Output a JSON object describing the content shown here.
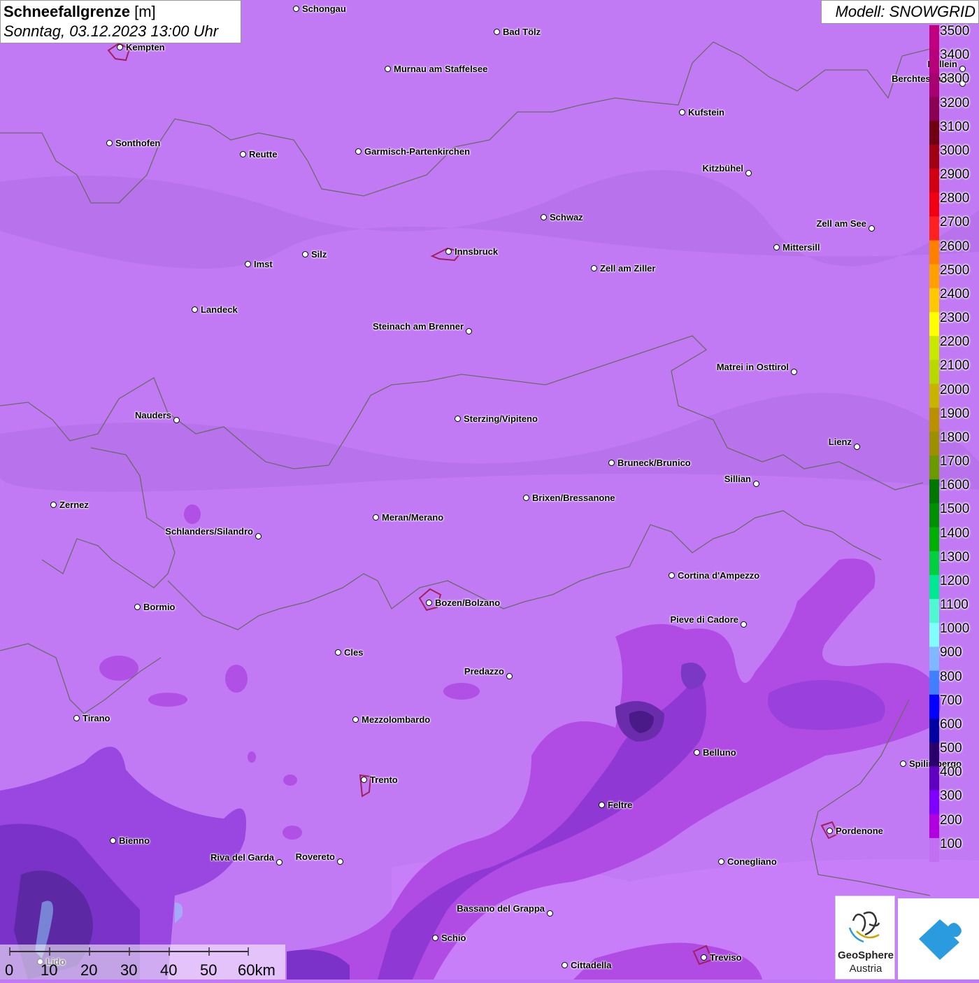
{
  "title": {
    "main": "Schneefallgrenze",
    "unit": "[m]",
    "datetime": "Sonntag, 03.12.2023 13:00 Uhr"
  },
  "model": "Modell: SNOWGRID",
  "legend": {
    "labels": [
      "3500",
      "3400",
      "3300",
      "3200",
      "3100",
      "3000",
      "2900",
      "2800",
      "2700",
      "2600",
      "2500",
      "2400",
      "2300",
      "2200",
      "2100",
      "2000",
      "1900",
      "1800",
      "1700",
      "1600",
      "1500",
      "1400",
      "1300",
      "1200",
      "1100",
      "1000",
      "900",
      "800",
      "700",
      "600",
      "500",
      "400",
      "300",
      "200",
      "100"
    ],
    "colors": [
      "#c0007e",
      "#b8007a",
      "#a80070",
      "#8a0052",
      "#6e0012",
      "#a00010",
      "#d00010",
      "#f00010",
      "#ff2020",
      "#ff8000",
      "#ffa000",
      "#ffc800",
      "#ffff00",
      "#c8e800",
      "#b8d800",
      "#c8b400",
      "#b89000",
      "#9a9000",
      "#6a9a00",
      "#007800",
      "#009000",
      "#00b000",
      "#00d040",
      "#00e890",
      "#50f8d0",
      "#80ffff",
      "#80b8ff",
      "#4080ff",
      "#0000ff",
      "#0000a0",
      "#2a006a",
      "#6000c0",
      "#8000ff",
      "#b000e0",
      "#c070f0"
    ]
  },
  "cities": [
    {
      "name": "Schongau"
    },
    {
      "name": "Bad Tölz"
    },
    {
      "name": "Kempten"
    },
    {
      "name": "Murnau am Staffelsee"
    },
    {
      "name": "Berchtesgaden"
    },
    {
      "name": "Kufstein"
    },
    {
      "name": "Sonthofen"
    },
    {
      "name": "Reutte"
    },
    {
      "name": "Garmisch-Partenkirchen"
    },
    {
      "name": "Kitzbühel"
    },
    {
      "name": "Schwaz"
    },
    {
      "name": "Zell am See"
    },
    {
      "name": "Mittersill"
    },
    {
      "name": "Innsbruck"
    },
    {
      "name": "Silz"
    },
    {
      "name": "Imst"
    },
    {
      "name": "Zell am Ziller"
    },
    {
      "name": "Landeck"
    },
    {
      "name": "Steinach am Brenner"
    },
    {
      "name": "Matrei in Osttirol"
    },
    {
      "name": "Nauders"
    },
    {
      "name": "Sterzing/Vipiteno"
    },
    {
      "name": "Lienz"
    },
    {
      "name": "Bruneck/Brunico"
    },
    {
      "name": "Sillian"
    },
    {
      "name": "Zernez"
    },
    {
      "name": "Brixen/Bressanone"
    },
    {
      "name": "Meran/Merano"
    },
    {
      "name": "Schlanders/Silandro"
    },
    {
      "name": "Cortina d'Ampezzo"
    },
    {
      "name": "Bormio"
    },
    {
      "name": "Bozen/Bolzano"
    },
    {
      "name": "Pieve di Cadore"
    },
    {
      "name": "Cles"
    },
    {
      "name": "Predazzo"
    },
    {
      "name": "Tirano"
    },
    {
      "name": "Mezzolombardo"
    },
    {
      "name": "Belluno"
    },
    {
      "name": "Spilimbergo"
    },
    {
      "name": "Trento"
    },
    {
      "name": "Feltre"
    },
    {
      "name": "Pordenone"
    },
    {
      "name": "Bienno"
    },
    {
      "name": "Riva del Garda"
    },
    {
      "name": "Rovereto"
    },
    {
      "name": "Conegliano"
    },
    {
      "name": "Bassano del Grappa"
    },
    {
      "name": "Schio"
    },
    {
      "name": "Treviso"
    },
    {
      "name": "Cittadella"
    },
    {
      "name": "Hallein"
    },
    {
      "name": "Lido"
    }
  ],
  "scale": {
    "labels": [
      "0",
      "10",
      "20",
      "30",
      "40",
      "50",
      "60km"
    ]
  },
  "logos": {
    "geosphere": "GeoSphere",
    "geosphere_sub": "Austria"
  }
}
